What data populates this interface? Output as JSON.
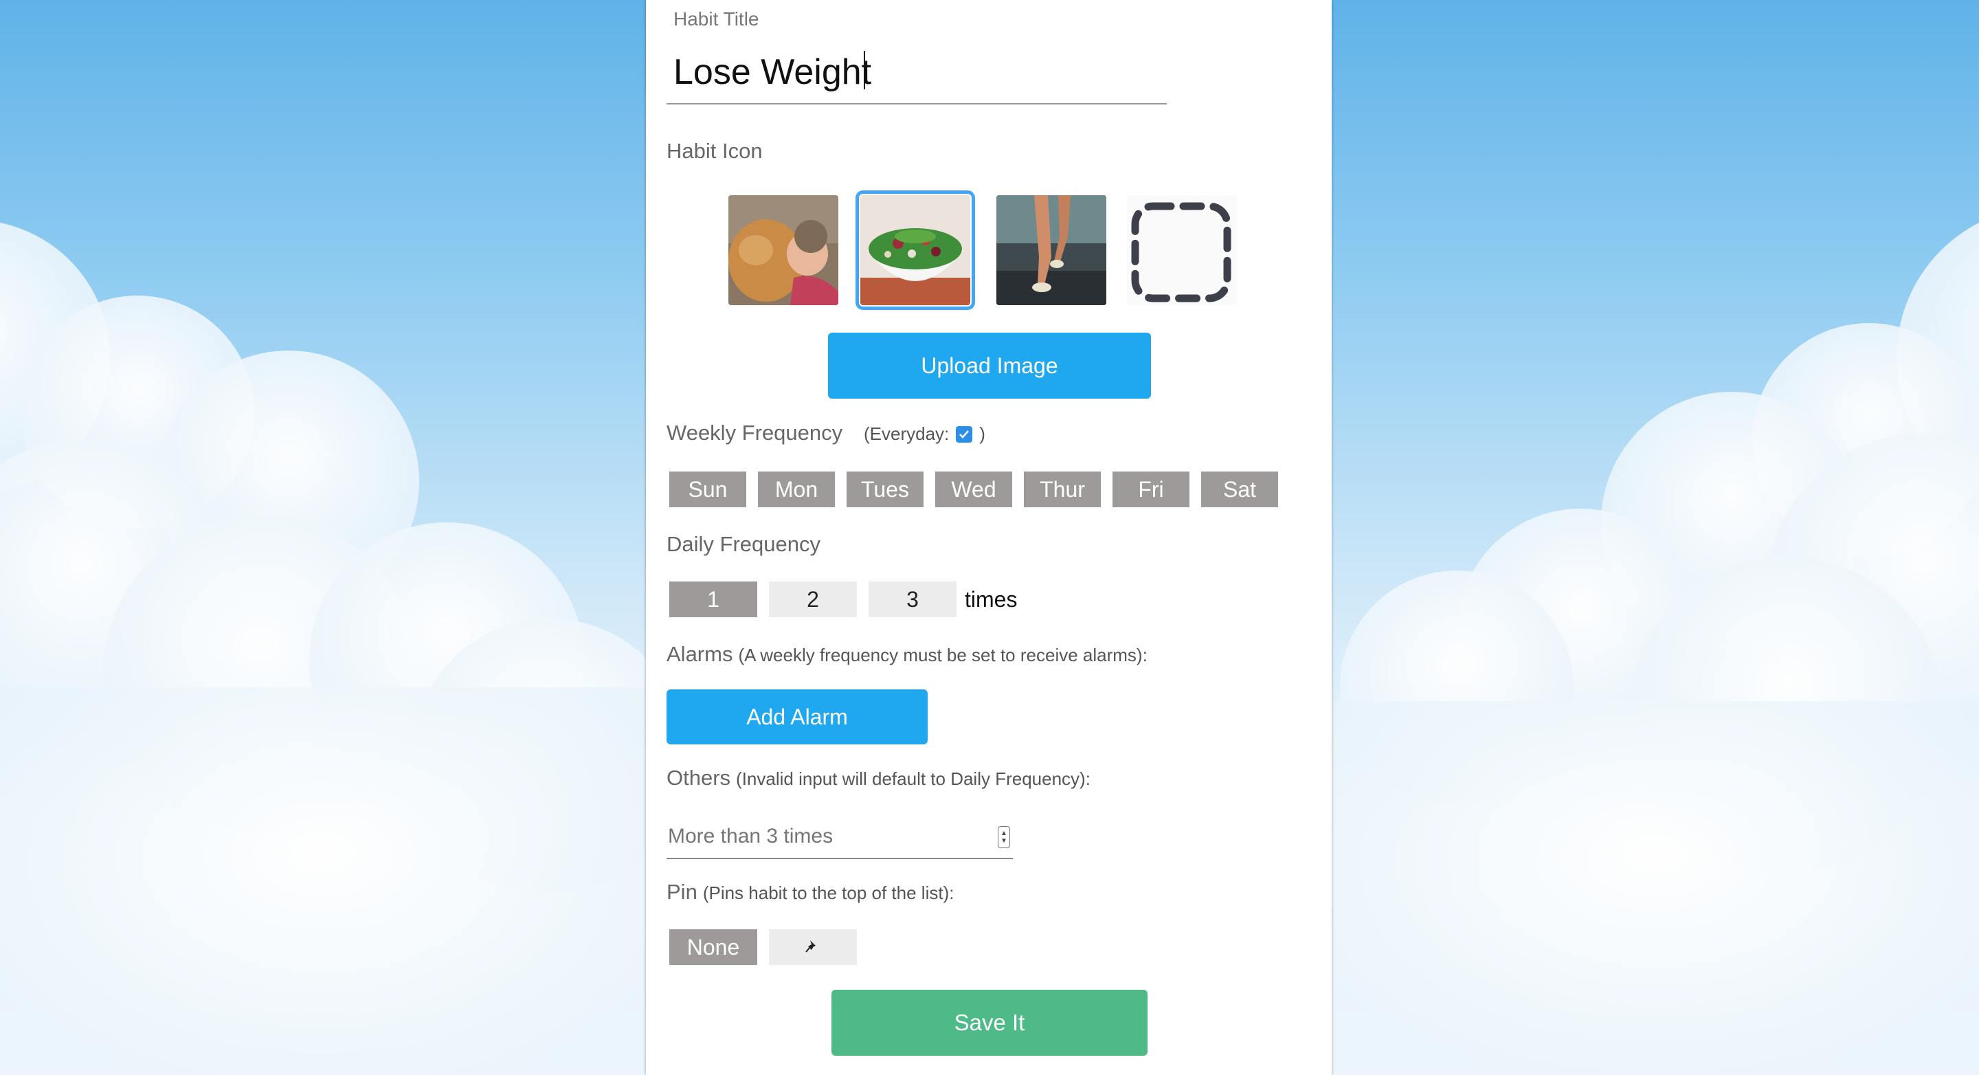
{
  "form": {
    "title_label": "Habit Title",
    "title_value": "Lose Weight",
    "icon_label": "Habit Icon",
    "icons": [
      {
        "name": "cat-baby-image",
        "selected": false
      },
      {
        "name": "salad-image",
        "selected": true
      },
      {
        "name": "running-legs-image",
        "selected": false
      },
      {
        "name": "dashed-placeholder-icon",
        "selected": false
      }
    ],
    "upload_label": "Upload Image",
    "weekly_label": "Weekly Frequency",
    "everyday_label": "(Everyday:",
    "everyday_close": ")",
    "everyday_checked": true,
    "days": [
      "Sun",
      "Mon",
      "Tues",
      "Wed",
      "Thur",
      "Fri",
      "Sat"
    ],
    "daily_label": "Daily Frequency",
    "daily_options": [
      "1",
      "2",
      "3"
    ],
    "daily_selected": "1",
    "times_label": "times",
    "alarms_label": "Alarms",
    "alarms_hint": "(A weekly frequency must be set to receive alarms)",
    "alarms_colon": ":",
    "add_alarm_label": "Add Alarm",
    "others_label": "Others",
    "others_hint": "(Invalid input will default to Daily Frequency)",
    "others_colon": ":",
    "others_placeholder": "More than 3 times",
    "pin_label": "Pin",
    "pin_hint": "(Pins habit to the top of the list)",
    "pin_colon": ":",
    "pin_none_label": "None",
    "pin_icon": "pushpin-icon",
    "save_label": "Save It"
  },
  "colors": {
    "accent_blue": "#1fa8ef",
    "save_green": "#4dba87",
    "day_gray": "#9e9a99"
  }
}
